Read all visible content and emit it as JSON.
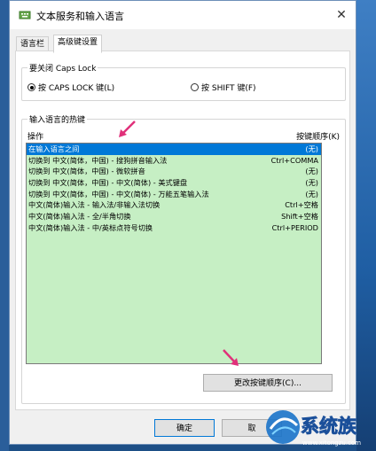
{
  "window": {
    "title": "文本服务和输入语言",
    "close_glyph": "✕"
  },
  "tabs": [
    {
      "label": "语言栏"
    },
    {
      "label": "高级键设置"
    }
  ],
  "caps_lock_group": {
    "title": "要关闭 Caps Lock",
    "options": [
      {
        "label": "按 CAPS LOCK 键(L)",
        "selected": true
      },
      {
        "label": "按 SHIFT 键(F)",
        "selected": false
      }
    ]
  },
  "hotkeys_group": {
    "title": "输入语言的热键",
    "columns": {
      "action": "操作",
      "sequence": "按键顺序(K)"
    },
    "rows": [
      {
        "action": "在输入语言之间",
        "keys": "(无)",
        "selected": true
      },
      {
        "action": "切换到 中文(简体，中国) - 搜狗拼音输入法",
        "keys": "Ctrl+COMMA"
      },
      {
        "action": "切换到 中文(简体，中国) - 微软拼音",
        "keys": "(无)"
      },
      {
        "action": "切换到 中文(简体，中国) - 中文(简体) - 美式键盘",
        "keys": "(无)"
      },
      {
        "action": "切换到 中文(简体，中国) - 中文(简体) - 万能五笔输入法",
        "keys": "(无)"
      },
      {
        "action": "中文(简体)输入法 - 输入法/非输入法切换",
        "keys": "Ctrl+空格"
      },
      {
        "action": "中文(简体)输入法 - 全/半角切换",
        "keys": "Shift+空格"
      },
      {
        "action": "中文(简体)输入法 - 中/英标点符号切换",
        "keys": "Ctrl+PERIOD"
      }
    ],
    "change_sequence_label": "更改按键顺序(C)..."
  },
  "footer": {
    "ok_label": "确定",
    "cancel_label": "取"
  },
  "watermark": {
    "brand": "系统族",
    "url": "www.xitongzu.com"
  },
  "colors": {
    "selection": "#0078d7",
    "list_bg": "#c6efc4",
    "arrow": "#e0307a"
  }
}
